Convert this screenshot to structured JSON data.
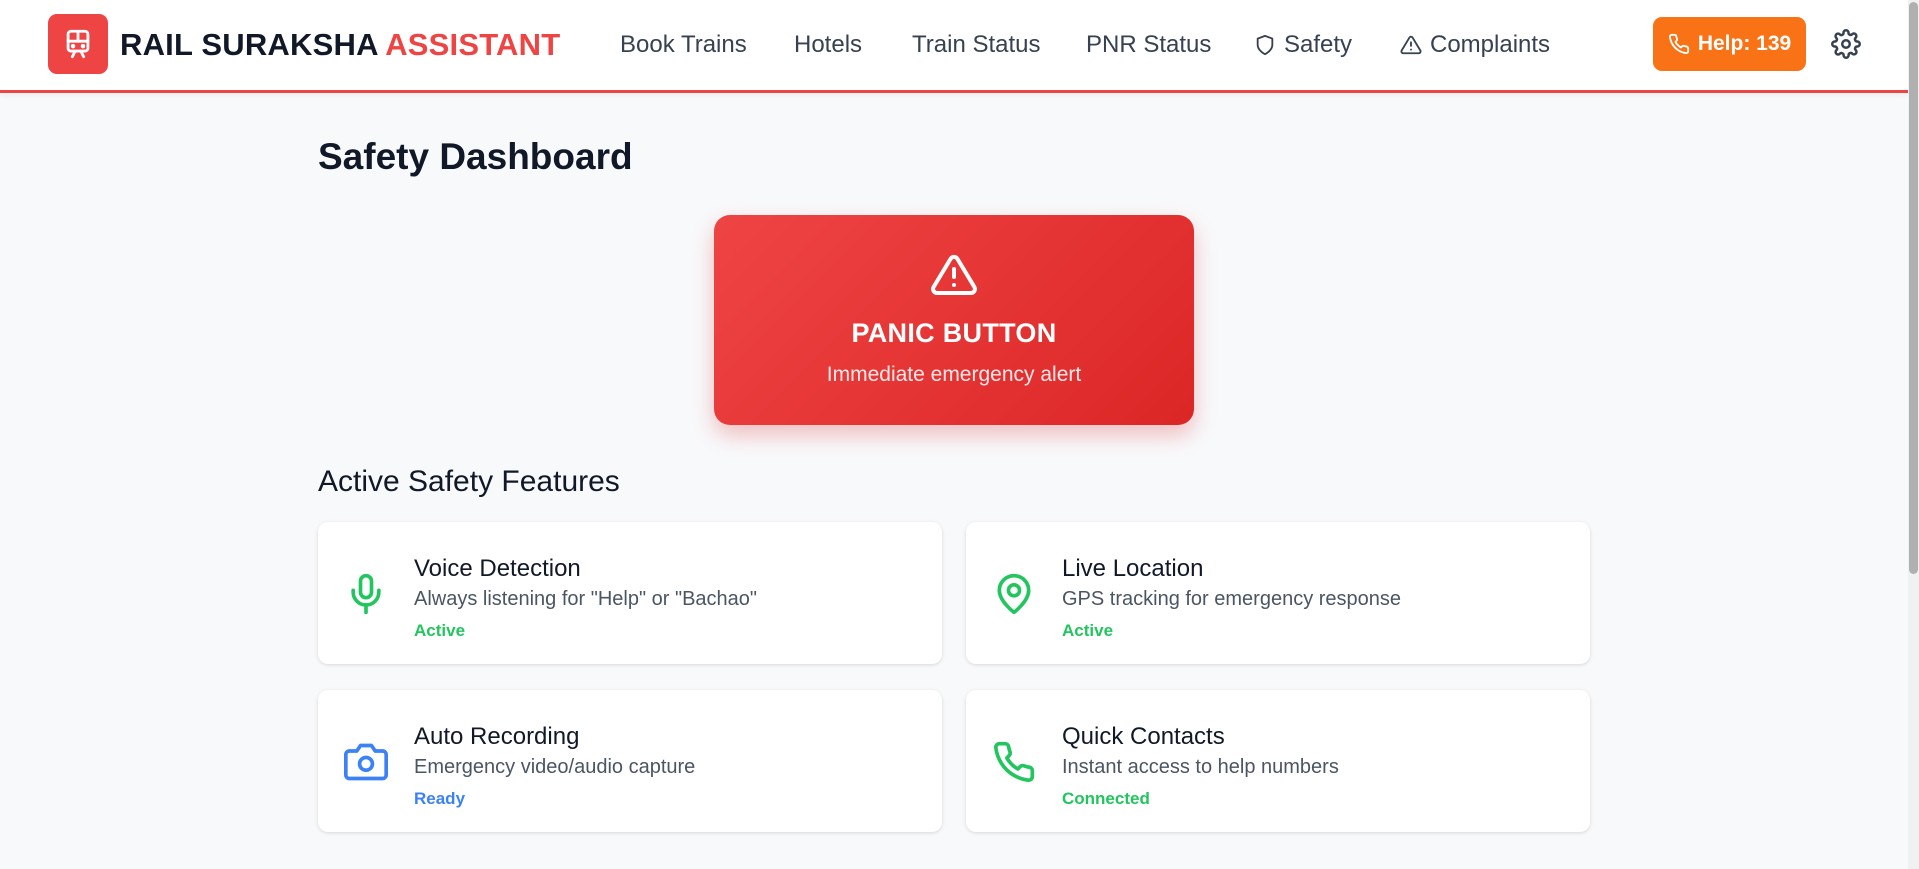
{
  "brand": {
    "part1": "RAIL SURAKSHA",
    "part2": "ASSISTANT",
    "logo_icon": "train-icon"
  },
  "nav": {
    "items": [
      {
        "label": "Book Trains"
      },
      {
        "label": "Hotels"
      },
      {
        "label": "Train Status"
      },
      {
        "label": "PNR Status"
      },
      {
        "label": "Safety",
        "icon": "shield-icon"
      },
      {
        "label": "Complaints",
        "icon": "alert-triangle-icon"
      }
    ]
  },
  "help_button": {
    "label": "Help: 139",
    "icon": "phone-icon"
  },
  "settings": {
    "icon": "gear-icon"
  },
  "page": {
    "title": "Safety Dashboard"
  },
  "panic": {
    "icon": "alert-triangle-icon",
    "title": "PANIC BUTTON",
    "subtitle": "Immediate emergency alert"
  },
  "features": {
    "title": "Active Safety Features",
    "cards": [
      {
        "title": "Voice Detection",
        "description": "Always listening for \"Help\" or \"Bachao\"",
        "status": "Active",
        "icon": "microphone-icon",
        "color": "#22c55e"
      },
      {
        "title": "Live Location",
        "description": "GPS tracking for emergency response",
        "status": "Active",
        "icon": "map-pin-icon",
        "color": "#22c55e"
      },
      {
        "title": "Auto Recording",
        "description": "Emergency video/audio capture",
        "status": "Ready",
        "icon": "camera-icon",
        "color": "#3b82f6"
      },
      {
        "title": "Quick Contacts",
        "description": "Instant access to help numbers",
        "status": "Connected",
        "icon": "phone-icon",
        "color": "#22c55e"
      }
    ]
  },
  "colors": {
    "accent": "#ef4444",
    "help": "#f97316",
    "active": "#22c55e",
    "ready": "#3b82f6"
  }
}
